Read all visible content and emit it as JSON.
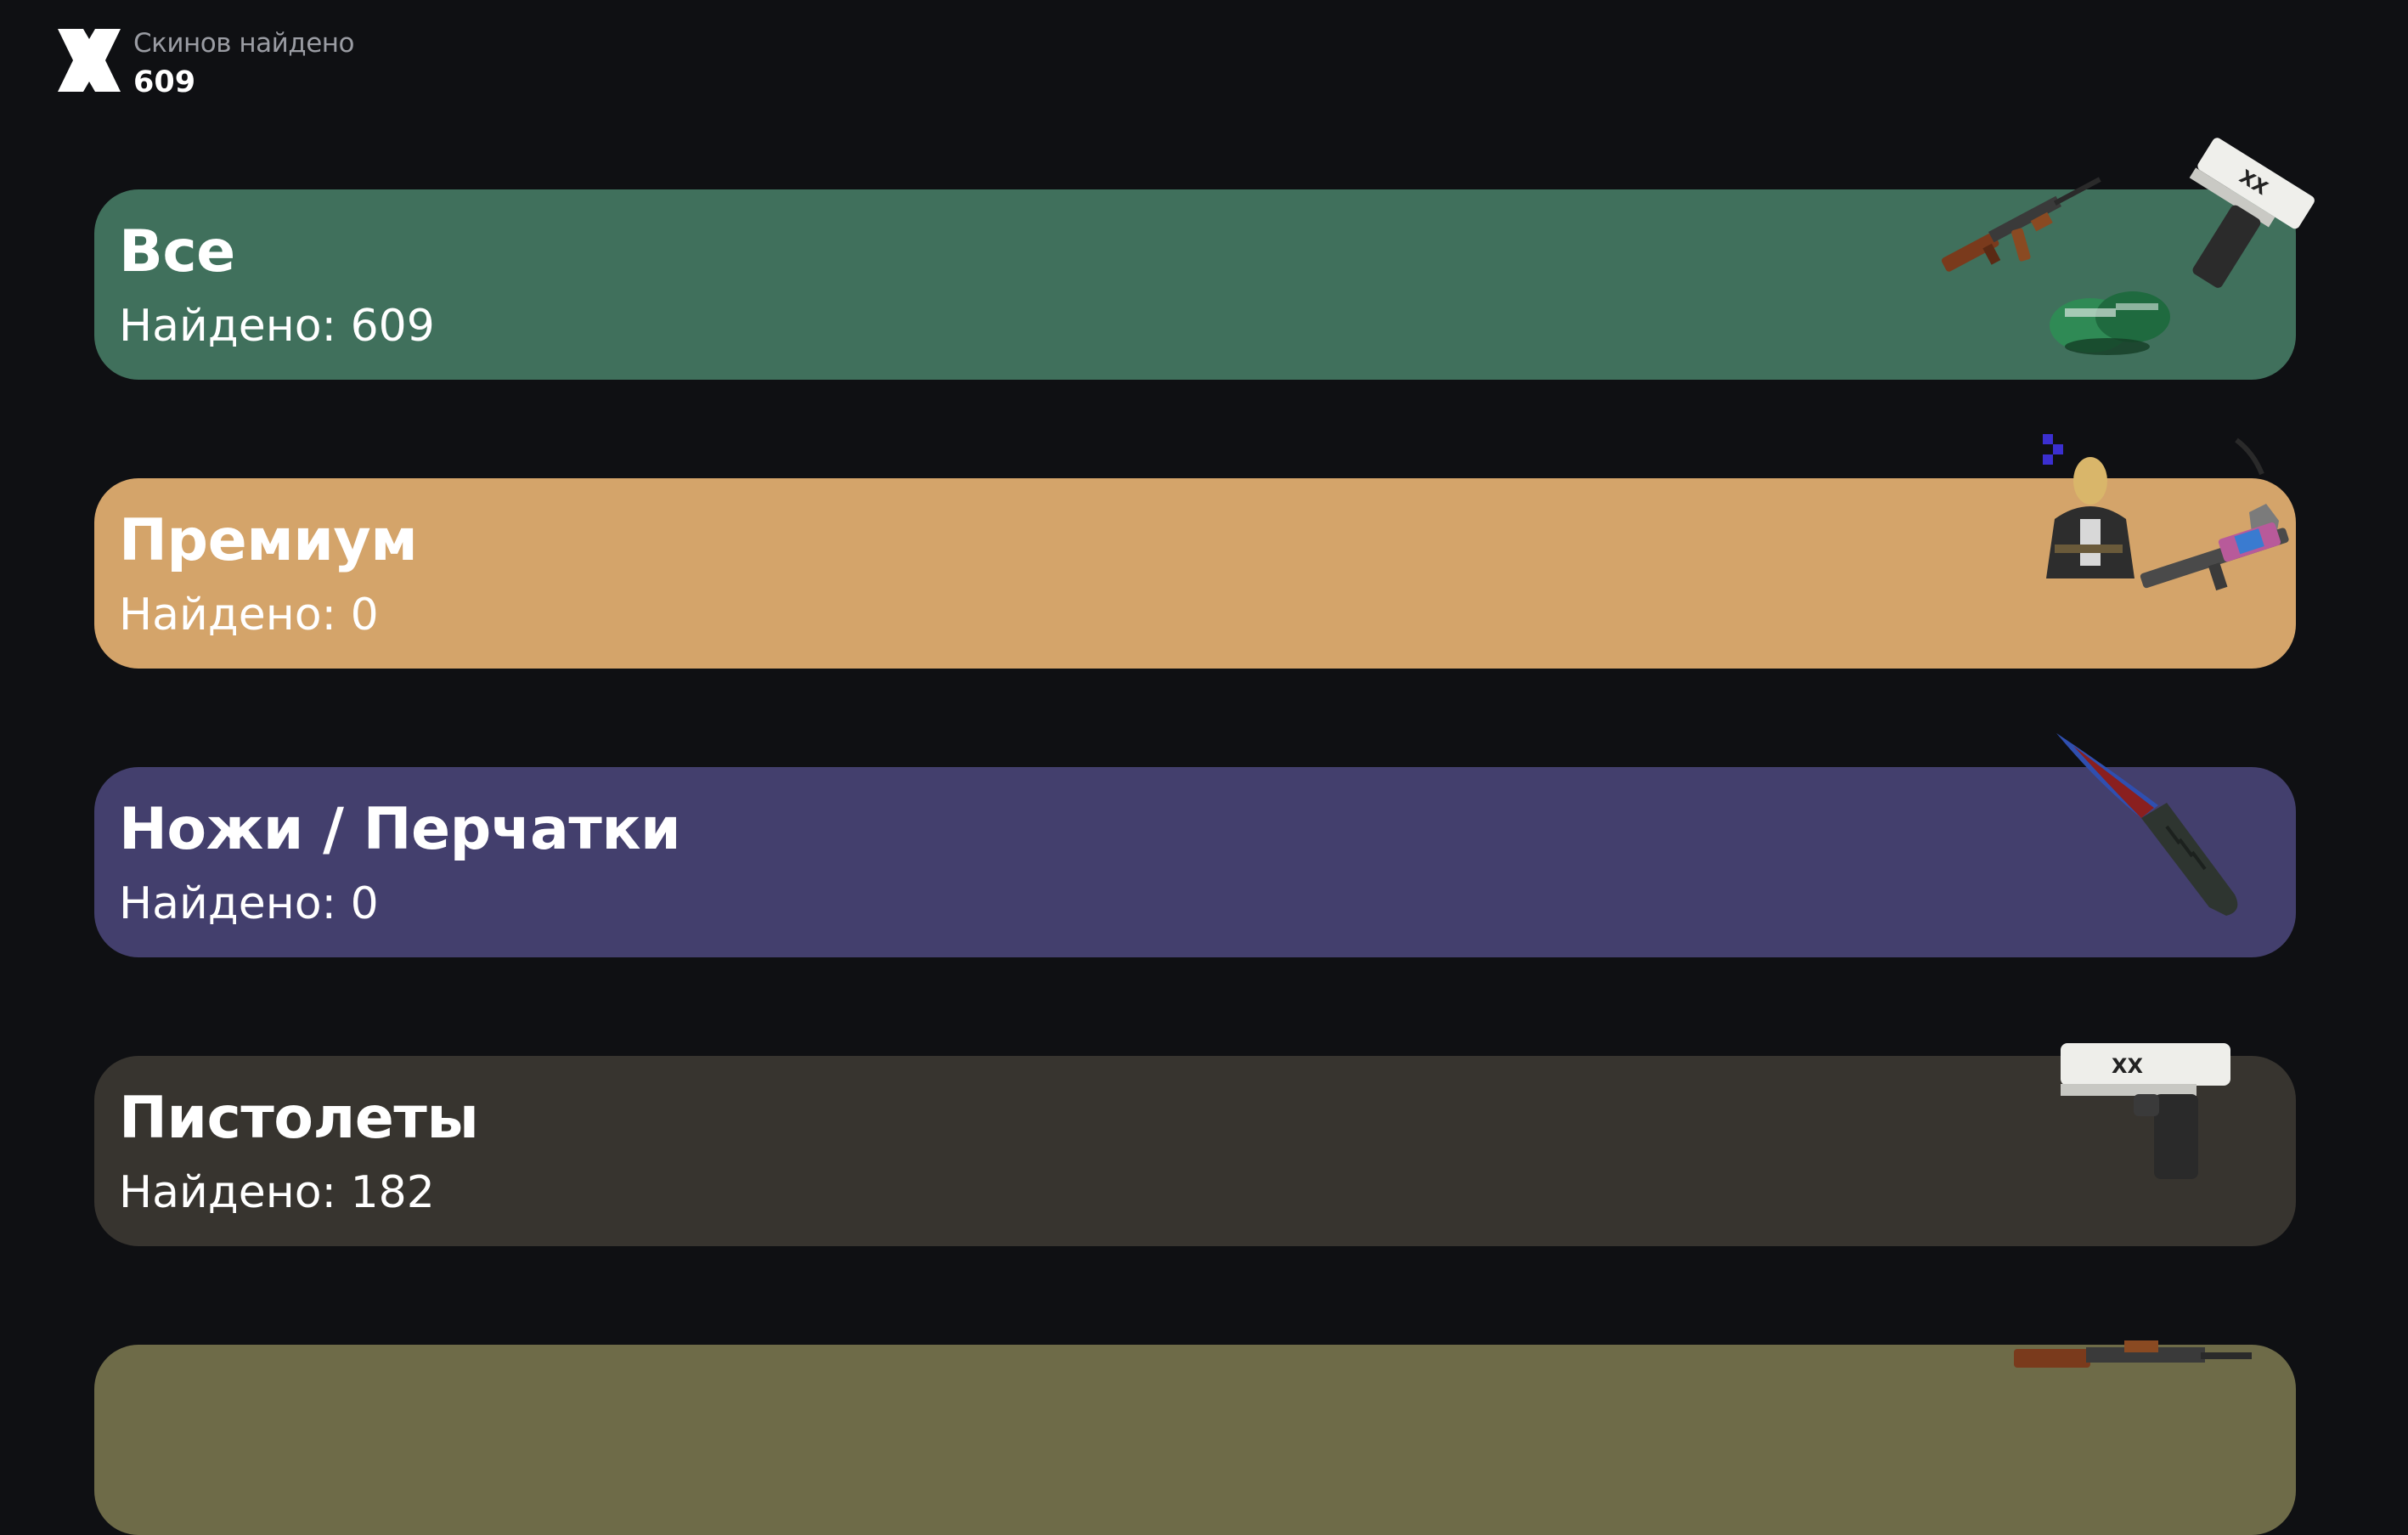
{
  "header": {
    "label": "Скинов найдено",
    "count": "609"
  },
  "categories": [
    {
      "title": "Все",
      "found": "Найдено: 609",
      "color": "#40705c",
      "icons": [
        "ak47-icon",
        "gloves-icon",
        "deagle-icon"
      ]
    },
    {
      "title": "Премиум",
      "found": "Найдено: 0",
      "color": "#d4a46a",
      "icons": [
        "agent-icon",
        "gloves-icon",
        "rifle-icon"
      ]
    },
    {
      "title": "Ножи / Перчатки",
      "found": "Найдено: 0",
      "color": "#433f6d",
      "icons": [
        "knife-icon"
      ]
    },
    {
      "title": "Пистолеты",
      "found": "Найдено: 182",
      "color": "#37342f",
      "icons": [
        "deagle-icon"
      ]
    },
    {
      "title": "",
      "found": "",
      "color": "#6e6b48",
      "icons": [
        "ak47-icon"
      ]
    }
  ]
}
